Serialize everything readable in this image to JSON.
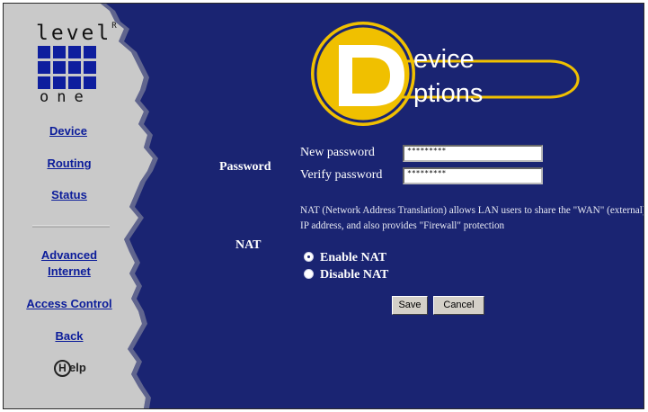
{
  "logo": {
    "top_text": "level",
    "superscript": "R",
    "bottom_text": "one"
  },
  "sidebar": {
    "items": [
      {
        "label": "Device"
      },
      {
        "label": "Routing"
      },
      {
        "label": "Status"
      },
      {
        "label": "Advanced Internet"
      },
      {
        "label": "Access Control"
      },
      {
        "label": "Back"
      }
    ],
    "help": {
      "letter": "H",
      "label": "elp"
    }
  },
  "header": {
    "initial": "D",
    "word1": "evice",
    "word2": "ptions"
  },
  "password_section": {
    "title": "Password",
    "new_label": "New password",
    "new_value": "*********",
    "verify_label": "Verify password",
    "verify_value": "*********"
  },
  "nat_section": {
    "title": "NAT",
    "description": "NAT (Network Address Translation) allows LAN users to share the \"WAN\" (external) IP address, and also provides \"Firewall\" protection",
    "enable_label": "Enable NAT",
    "disable_label": "Disable NAT",
    "selected": "enable"
  },
  "buttons": {
    "save": "Save",
    "cancel": "Cancel"
  },
  "colors": {
    "background": "#1a2472",
    "sidebar": "#c8c8c8",
    "link": "#0b1c9a",
    "badge": "#f0c000"
  }
}
